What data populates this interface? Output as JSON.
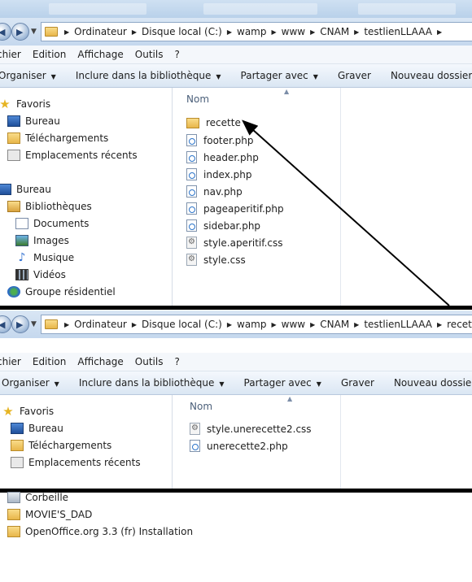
{
  "breadcrumbs_top": [
    "Ordinateur",
    "Disque local (C:)",
    "wamp",
    "www",
    "CNAM",
    "testlienLLAAA"
  ],
  "breadcrumbs_bottom": [
    "Ordinateur",
    "Disque local (C:)",
    "wamp",
    "www",
    "CNAM",
    "testlienLLAAA",
    "recette"
  ],
  "menu": [
    "chier",
    "Edition",
    "Affichage",
    "Outils",
    "?"
  ],
  "toolbar": {
    "organize": "Organiser",
    "include": "Inclure dans la bibliothèque",
    "share": "Partager avec",
    "burn": "Graver",
    "new_folder": "Nouveau dossier"
  },
  "nav_top": {
    "favorites": "Favoris",
    "desktop_fav": "Bureau",
    "downloads": "Téléchargements",
    "recent": "Emplacements récents",
    "desktop": "Bureau",
    "libraries": "Bibliothèques",
    "documents": "Documents",
    "images": "Images",
    "music": "Musique",
    "videos": "Vidéos",
    "homegroup": "Groupe résidentiel"
  },
  "nav_bottom": {
    "favorites": "Favoris",
    "desktop_fav": "Bureau",
    "downloads": "Téléchargements",
    "recent": "Emplacements récents"
  },
  "column_name": "Nom",
  "files_top": [
    {
      "name": "recette",
      "type": "folder"
    },
    {
      "name": "footer.php",
      "type": "php"
    },
    {
      "name": "header.php",
      "type": "php"
    },
    {
      "name": "index.php",
      "type": "php"
    },
    {
      "name": "nav.php",
      "type": "php"
    },
    {
      "name": "pageaperitif.php",
      "type": "php"
    },
    {
      "name": "sidebar.php",
      "type": "php"
    },
    {
      "name": "style.aperitif.css",
      "type": "css"
    },
    {
      "name": "style.css",
      "type": "css"
    }
  ],
  "files_bottom": [
    {
      "name": "style.unerecette2.css",
      "type": "css"
    },
    {
      "name": "unerecette2.php",
      "type": "php"
    }
  ],
  "extra_items": [
    "Corbeille",
    "MOVIE'S_DAD",
    "OpenOffice.org 3.3 (fr) Installation"
  ]
}
